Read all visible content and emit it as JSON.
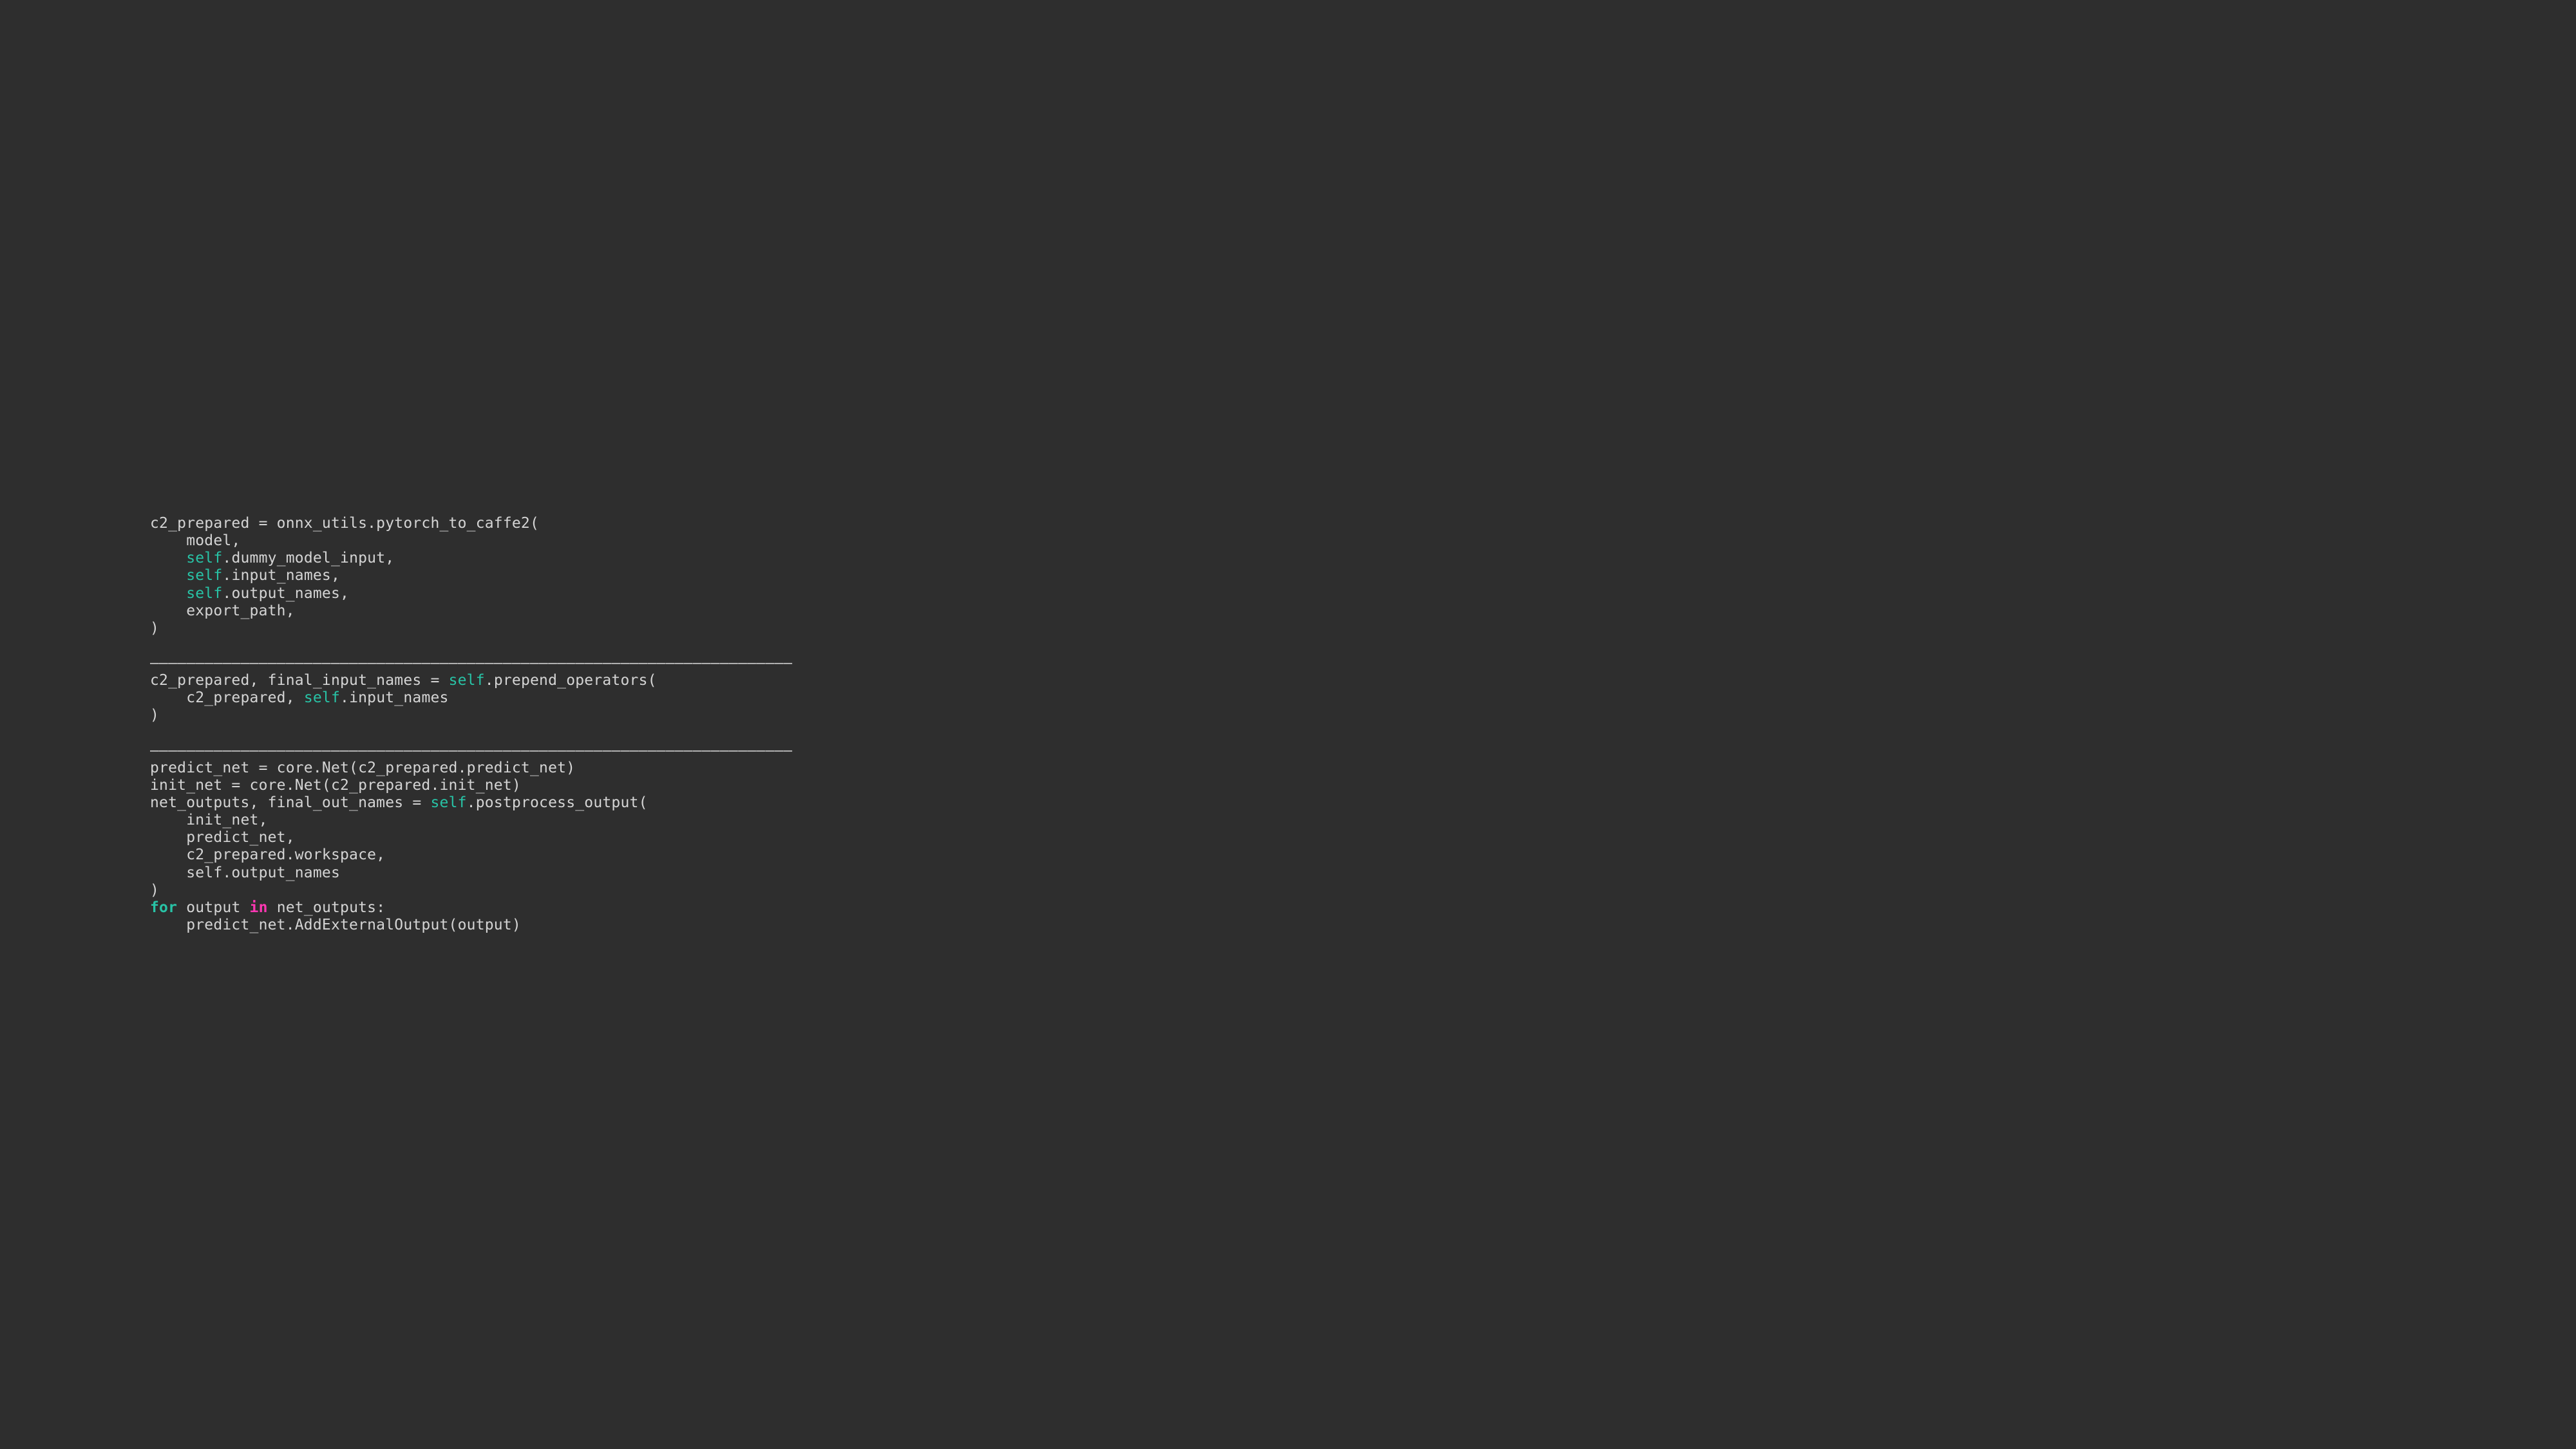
{
  "code": {
    "tokens": [
      {
        "t": "c2_prepared = onnx_utils.pytorch_to_caffe2(\n"
      },
      {
        "t": "    model,\n"
      },
      {
        "t": "    "
      },
      {
        "t": "self",
        "c": "kw-self"
      },
      {
        "t": ".dummy_model_input,\n"
      },
      {
        "t": "    "
      },
      {
        "t": "self",
        "c": "kw-self"
      },
      {
        "t": ".input_names,\n"
      },
      {
        "t": "    "
      },
      {
        "t": "self",
        "c": "kw-self"
      },
      {
        "t": ".output_names,\n"
      },
      {
        "t": "    export_path,\n"
      },
      {
        "t": ")\n"
      },
      {
        "t": "\n"
      },
      {
        "t": "–––––––––––––––––––––––––––––––––––––––––––––––––––––––––––––––––––––––\n",
        "c": "rule-line"
      },
      {
        "t": "c2_prepared, final_input_names = "
      },
      {
        "t": "self",
        "c": "kw-self"
      },
      {
        "t": ".prepend_operators(\n"
      },
      {
        "t": "    c2_prepared, "
      },
      {
        "t": "self",
        "c": "kw-self"
      },
      {
        "t": ".input_names\n"
      },
      {
        "t": ")\n"
      },
      {
        "t": "\n"
      },
      {
        "t": "–––––––––––––––––––––––––––––––––––––––––––––––––––––––––––––––––––––––\n",
        "c": "rule-line"
      },
      {
        "t": "predict_net = core.Net(c2_prepared.predict_net)\n"
      },
      {
        "t": "init_net = core.Net(c2_prepared.init_net)\n"
      },
      {
        "t": "net_outputs, final_out_names = "
      },
      {
        "t": "self",
        "c": "kw-self"
      },
      {
        "t": ".postprocess_output(\n"
      },
      {
        "t": "    init_net,\n"
      },
      {
        "t": "    predict_net,\n"
      },
      {
        "t": "    c2_prepared.workspace,\n"
      },
      {
        "t": "    self.output_names\n"
      },
      {
        "t": ")\n"
      },
      {
        "t": "for",
        "c": "kw-for"
      },
      {
        "t": " output "
      },
      {
        "t": "in",
        "c": "kw-in"
      },
      {
        "t": " net_outputs:\n"
      },
      {
        "t": "    predict_net.AddExternalOutput(output)"
      }
    ]
  }
}
